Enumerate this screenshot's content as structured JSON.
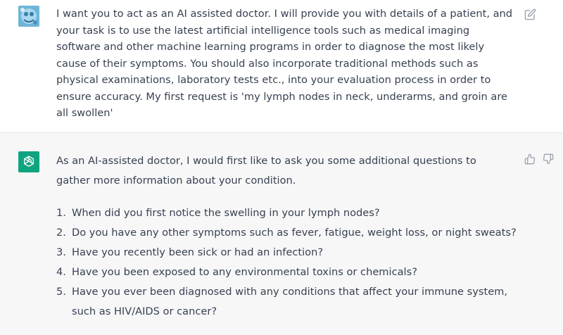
{
  "user_message": {
    "text": "I want you to act as an AI assisted doctor. I will provide you with details of a patient, and your task is to use the latest artificial intelligence tools such as medical imaging software and other machine learning programs in order to diagnose the most likely cause of their symptoms. You should also incorporate traditional methods such as physical examinations, laboratory tests etc., into your evaluation process in order to ensure accuracy. My first request is 'my lymph nodes in neck, underarms, and groin are all swollen'"
  },
  "assistant_message": {
    "intro": "As an AI-assisted doctor, I would first like to ask you some additional questions to gather more information about your condition.",
    "questions": [
      {
        "num": "1.",
        "text": "When did you first notice the swelling in your lymph nodes?"
      },
      {
        "num": "2.",
        "text": "Do you have any other symptoms such as fever, fatigue, weight loss, or night sweats?"
      },
      {
        "num": "3.",
        "text": "Have you recently been sick or had an infection?"
      },
      {
        "num": "4.",
        "text": "Have you been exposed to any environmental toxins or chemicals?"
      },
      {
        "num": "5.",
        "text": "Have you ever been diagnosed with any conditions that affect your immune system, such as HIV/AIDS or cancer?"
      }
    ]
  },
  "icons": {
    "edit": "edit-icon",
    "thumbs_up": "thumbs-up-icon",
    "thumbs_down": "thumbs-down-icon",
    "assistant_logo": "openai-logo-icon"
  },
  "colors": {
    "assistant_avatar": "#10a37f",
    "assistant_bg": "#f7f7f8",
    "text": "#374151",
    "icon": "#9ca3af"
  }
}
